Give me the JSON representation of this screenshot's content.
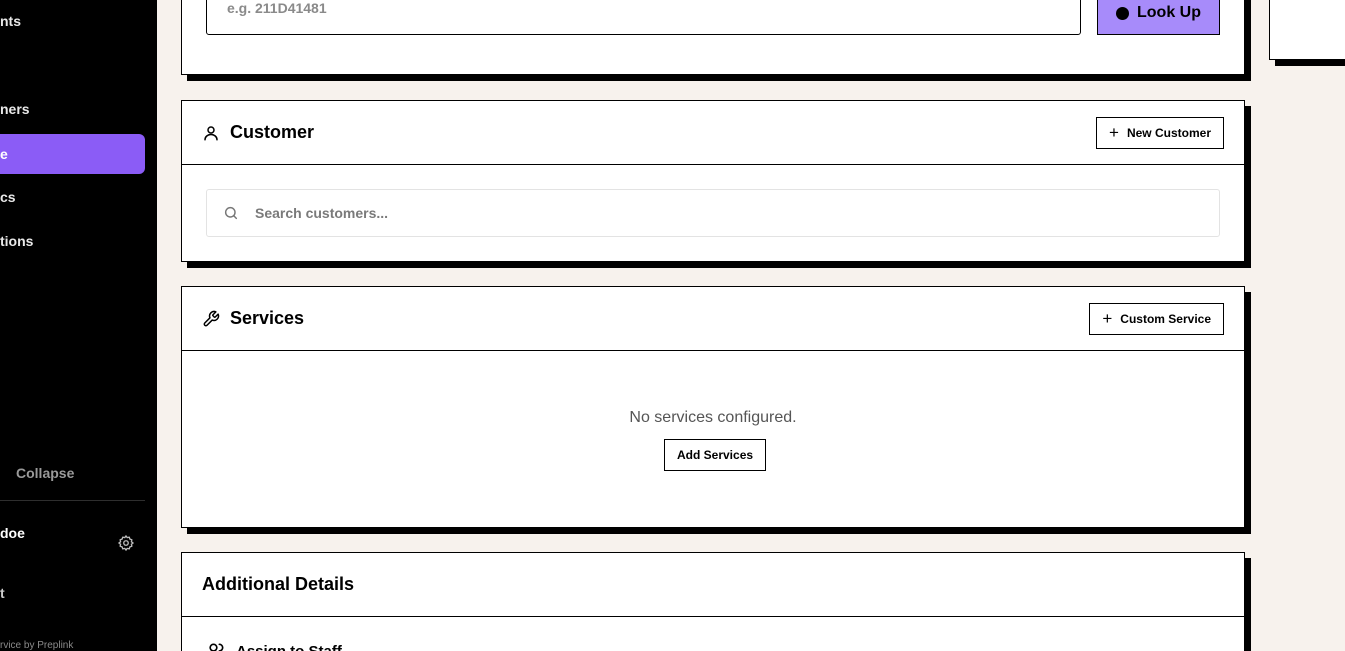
{
  "sidebar": {
    "items": [
      {
        "label": "nts",
        "active": false
      },
      {
        "label": "ners",
        "active": false
      },
      {
        "label": "e",
        "active": true
      },
      {
        "label": "cs",
        "active": false
      },
      {
        "label": "tions",
        "active": false
      }
    ],
    "collapse_label": "Collapse",
    "collapse_icon": "chevron-left-icon",
    "user_name": "doe",
    "bottom_item": "t",
    "powered_by": "rvice by Preplink",
    "accent_color": "#8b5cf6"
  },
  "lookup": {
    "placeholder": "e.g. 211D41481",
    "button_label": "Look Up",
    "button_color": "#a78bfa"
  },
  "customer": {
    "title": "Customer",
    "icon": "user-icon",
    "new_button_label": "New Customer",
    "search_placeholder": "Search customers..."
  },
  "services": {
    "title": "Services",
    "icon": "wrench-icon",
    "custom_button_label": "Custom Service",
    "empty_text": "No services configured.",
    "add_button_label": "Add Services"
  },
  "additional": {
    "title": "Additional Details",
    "assign_label": "Assign to Staff",
    "assign_icon": "users-icon"
  },
  "colors": {
    "page_bg": "#f7f2ed",
    "sidebar_bg": "#000000"
  }
}
